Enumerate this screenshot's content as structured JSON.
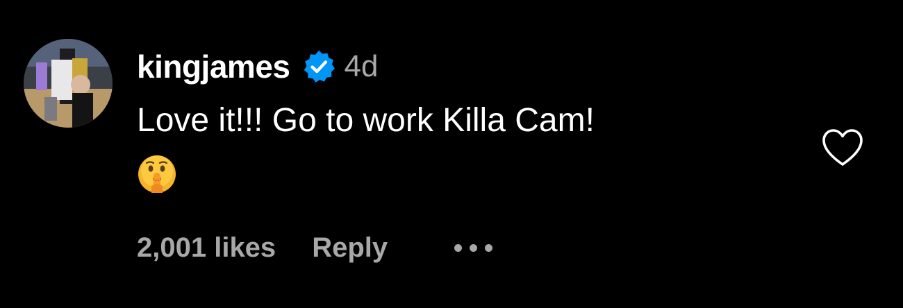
{
  "comment": {
    "username": "kingjames",
    "verified": true,
    "verified_icon": "verified-badge-icon",
    "timestamp": "4d",
    "text": "Love it!!! Go to work Killa Cam!",
    "emoji": "shushing-face-emoji",
    "likes": "2,001 likes",
    "reply_label": "Reply",
    "more_icon": "more-options-icon",
    "like_icon": "heart-icon"
  },
  "colors": {
    "background": "#000000",
    "primary_text": "#ffffff",
    "secondary_text": "#a8a8a8",
    "verified_blue": "#0095f6"
  }
}
